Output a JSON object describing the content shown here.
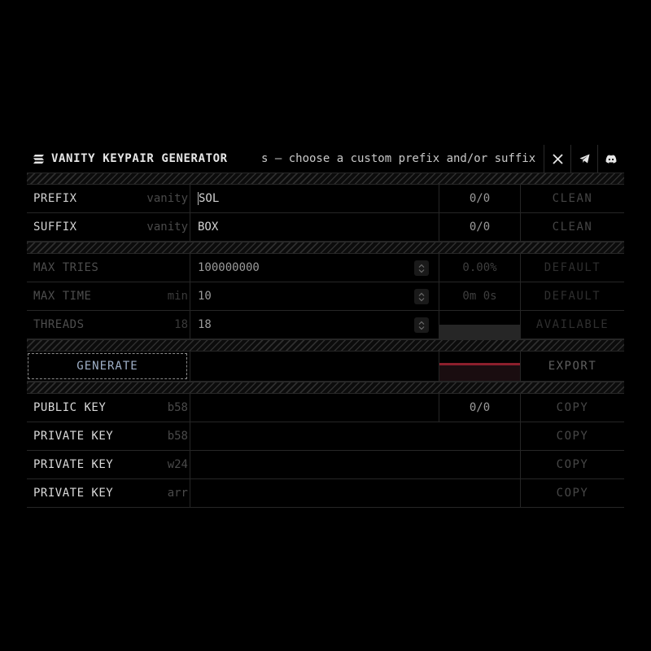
{
  "header": {
    "title": "VANITY KEYPAIR GENERATOR",
    "ticker": "s — choose a custom prefix and/or suffix",
    "socials": [
      "x-icon",
      "telegram-icon",
      "discord-icon"
    ]
  },
  "pattern_rows": [
    {
      "label": "PREFIX",
      "hint": "vanity",
      "value": "SOL",
      "count": "0/0",
      "action": "CLEAN"
    },
    {
      "label": "SUFFIX",
      "hint": "vanity",
      "value": "BOX",
      "count": "0/0",
      "action": "CLEAN"
    }
  ],
  "limits": {
    "max_tries": {
      "label": "MAX TRIES",
      "hint": "",
      "value": "100000000",
      "stat": "0.00%",
      "action": "DEFAULT"
    },
    "max_time": {
      "label": "MAX TIME",
      "hint": "min",
      "value": "10",
      "stat": "0m 0s",
      "action": "DEFAULT"
    },
    "threads": {
      "label": "THREADS",
      "hint": "18",
      "value": "18",
      "action": "AVAILABLE"
    }
  },
  "generate": {
    "label": "GENERATE",
    "export_label": "EXPORT"
  },
  "outputs": [
    {
      "label": "PUBLIC KEY",
      "hint": "b58",
      "value": "",
      "count": "0/0",
      "action": "COPY"
    },
    {
      "label": "PRIVATE KEY",
      "hint": "b58",
      "value": "",
      "action": "COPY"
    },
    {
      "label": "PRIVATE KEY",
      "hint": "w24",
      "value": "",
      "action": "COPY"
    },
    {
      "label": "PRIVATE KEY",
      "hint": "arr",
      "value": "",
      "action": "COPY"
    }
  ],
  "colors": {
    "background": "#000000",
    "progress": "#8c1f2c",
    "generate_text": "#9fb0c8"
  }
}
